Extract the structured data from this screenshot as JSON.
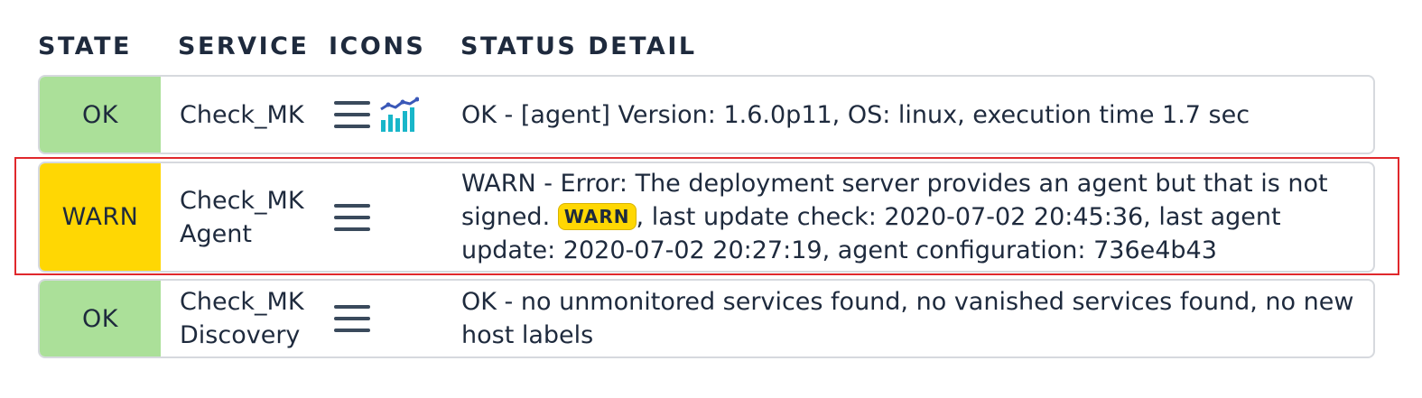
{
  "columns": {
    "state": "STATE",
    "service": "SERVICE",
    "icons": "ICONS",
    "status_detail": "STATUS DETAIL"
  },
  "rows": [
    {
      "state": "OK",
      "service_line1": "Check_MK",
      "service_line2": "",
      "icons": [
        "menu-icon",
        "graph-icon"
      ],
      "detail_text": "OK - [agent] Version: 1.6.0p11, OS: linux, execution time 1.7 sec"
    },
    {
      "state": "WARN",
      "service_line1": "Check_MK",
      "service_line2": "Agent",
      "icons": [
        "menu-icon"
      ],
      "detail_before": "WARN - Error: The deployment server provides an agent but that is not signed.",
      "detail_badge": "WARN",
      "detail_after": ", last update check: 2020-07-02 20:45:36, last agent update: 2020-07-02 20:27:19, agent configuration: 736e4b43"
    },
    {
      "state": "OK",
      "service_line1": "Check_MK",
      "service_line2": "Discovery",
      "icons": [
        "menu-icon"
      ],
      "detail_text": "OK - no unmonitored services found, no vanished services found, no new host labels"
    }
  ],
  "colors": {
    "ok": "#abe099",
    "warn": "#ffd703",
    "highlight": "#e0282c",
    "text": "#1e2a3d"
  }
}
